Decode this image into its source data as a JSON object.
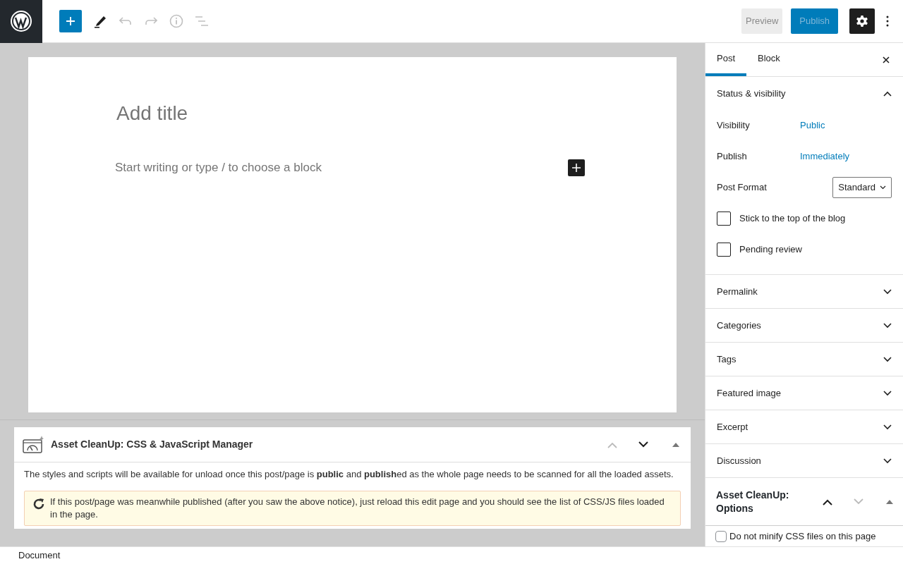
{
  "toolbar": {
    "tools": [
      {
        "kind": "inserter",
        "disabled": false
      },
      {
        "kind": "edit",
        "disabled": false
      },
      {
        "kind": "undo",
        "disabled": true
      },
      {
        "kind": "redo",
        "disabled": true
      },
      {
        "kind": "info",
        "disabled": true
      },
      {
        "kind": "outline",
        "disabled": true
      }
    ],
    "preview": {
      "label": "Preview",
      "disabled": true
    },
    "publish": {
      "label": "Publish",
      "disabled": true
    },
    "settings": {
      "on": true
    }
  },
  "editor": {
    "title_placeholder": "Add title",
    "body_placeholder": "Start writing or type / to choose a block"
  },
  "metabox": {
    "title": "Asset CleanUp: CSS & JavaScript Manager",
    "intro": "The styles and scripts will be available for unload once this post/page is **public** and **publish**ed as the whole page needs to be scanned for all the loaded assets.",
    "notice": "If this post/page was meanwhile published (after you saw the above notice), just reload this edit page and you should see the list of CSS/JS files loaded in the page."
  },
  "sidebar": {
    "tabs": [
      {
        "label": "Post",
        "selected": true
      },
      {
        "label": "Block",
        "selected": false
      }
    ],
    "panels": [
      {
        "title": "Status & visibility",
        "expanded": true,
        "rows": [
          {
            "label": "Visibility",
            "value": "Public"
          },
          {
            "label": "Publish",
            "value": "Immediately"
          }
        ],
        "post_format": {
          "label": "Post Format",
          "value": "Standard"
        },
        "checkboxes": [
          {
            "label": "Stick to the top of the blog",
            "checked": false
          },
          {
            "label": "Pending review",
            "checked": false
          }
        ]
      },
      {
        "title": "Permalink",
        "expanded": false
      },
      {
        "title": "Categories",
        "expanded": false
      },
      {
        "title": "Tags",
        "expanded": false
      },
      {
        "title": "Featured image",
        "expanded": false
      },
      {
        "title": "Excerpt",
        "expanded": false
      },
      {
        "title": "Discussion",
        "expanded": false
      }
    ],
    "asset_options": {
      "title": "Asset CleanUp: Options",
      "checkboxes": [
        {
          "label": "Do not minify CSS files on this page",
          "checked": false
        }
      ]
    }
  },
  "status_bar": {
    "breadcrumb": "Document"
  }
}
